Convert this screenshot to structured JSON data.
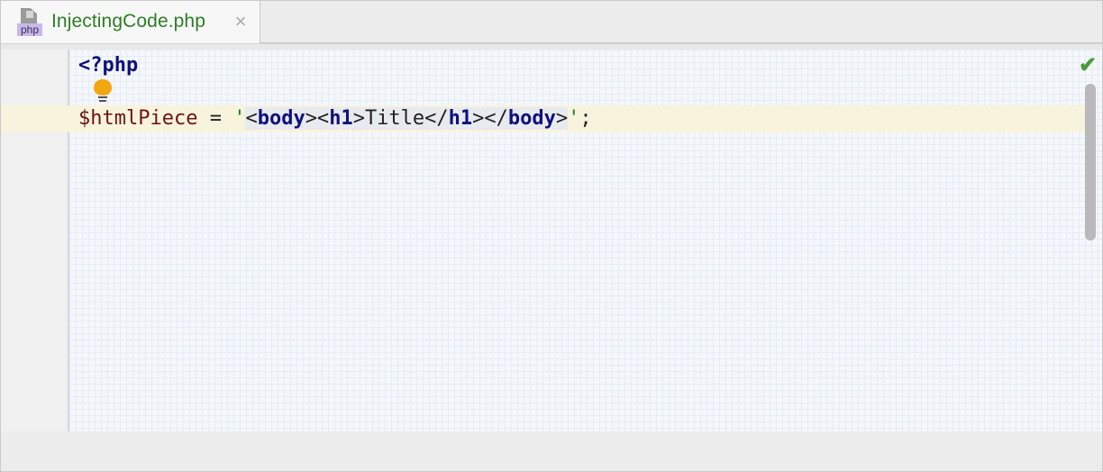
{
  "tab": {
    "title": "InjectingCode.php",
    "file_type_badge": "php",
    "close_icon": "×"
  },
  "editor": {
    "line1": {
      "open_tag": "<?php"
    },
    "line3": {
      "variable": "$htmlPiece",
      "assign": " = ",
      "quote_open": "'",
      "t1": "<",
      "body_open": "body",
      "t2": "><",
      "h1_open": "h1",
      "t3": ">",
      "text": "Title",
      "t4": "</",
      "h1_close": "h1",
      "t5": "></",
      "body_close": "body",
      "t6": ">",
      "quote_close": "'",
      "semicolon": ";"
    },
    "inspection_status_icon": "✔",
    "intention_icon": "lightbulb-icon"
  },
  "colors": {
    "tab_title": "#2f7d25",
    "keyword": "#10107a",
    "variable": "#6b1414",
    "string_quote": "#1f7a1f",
    "caret_row": "#f8f3dc",
    "bulb": "#f2a712"
  }
}
